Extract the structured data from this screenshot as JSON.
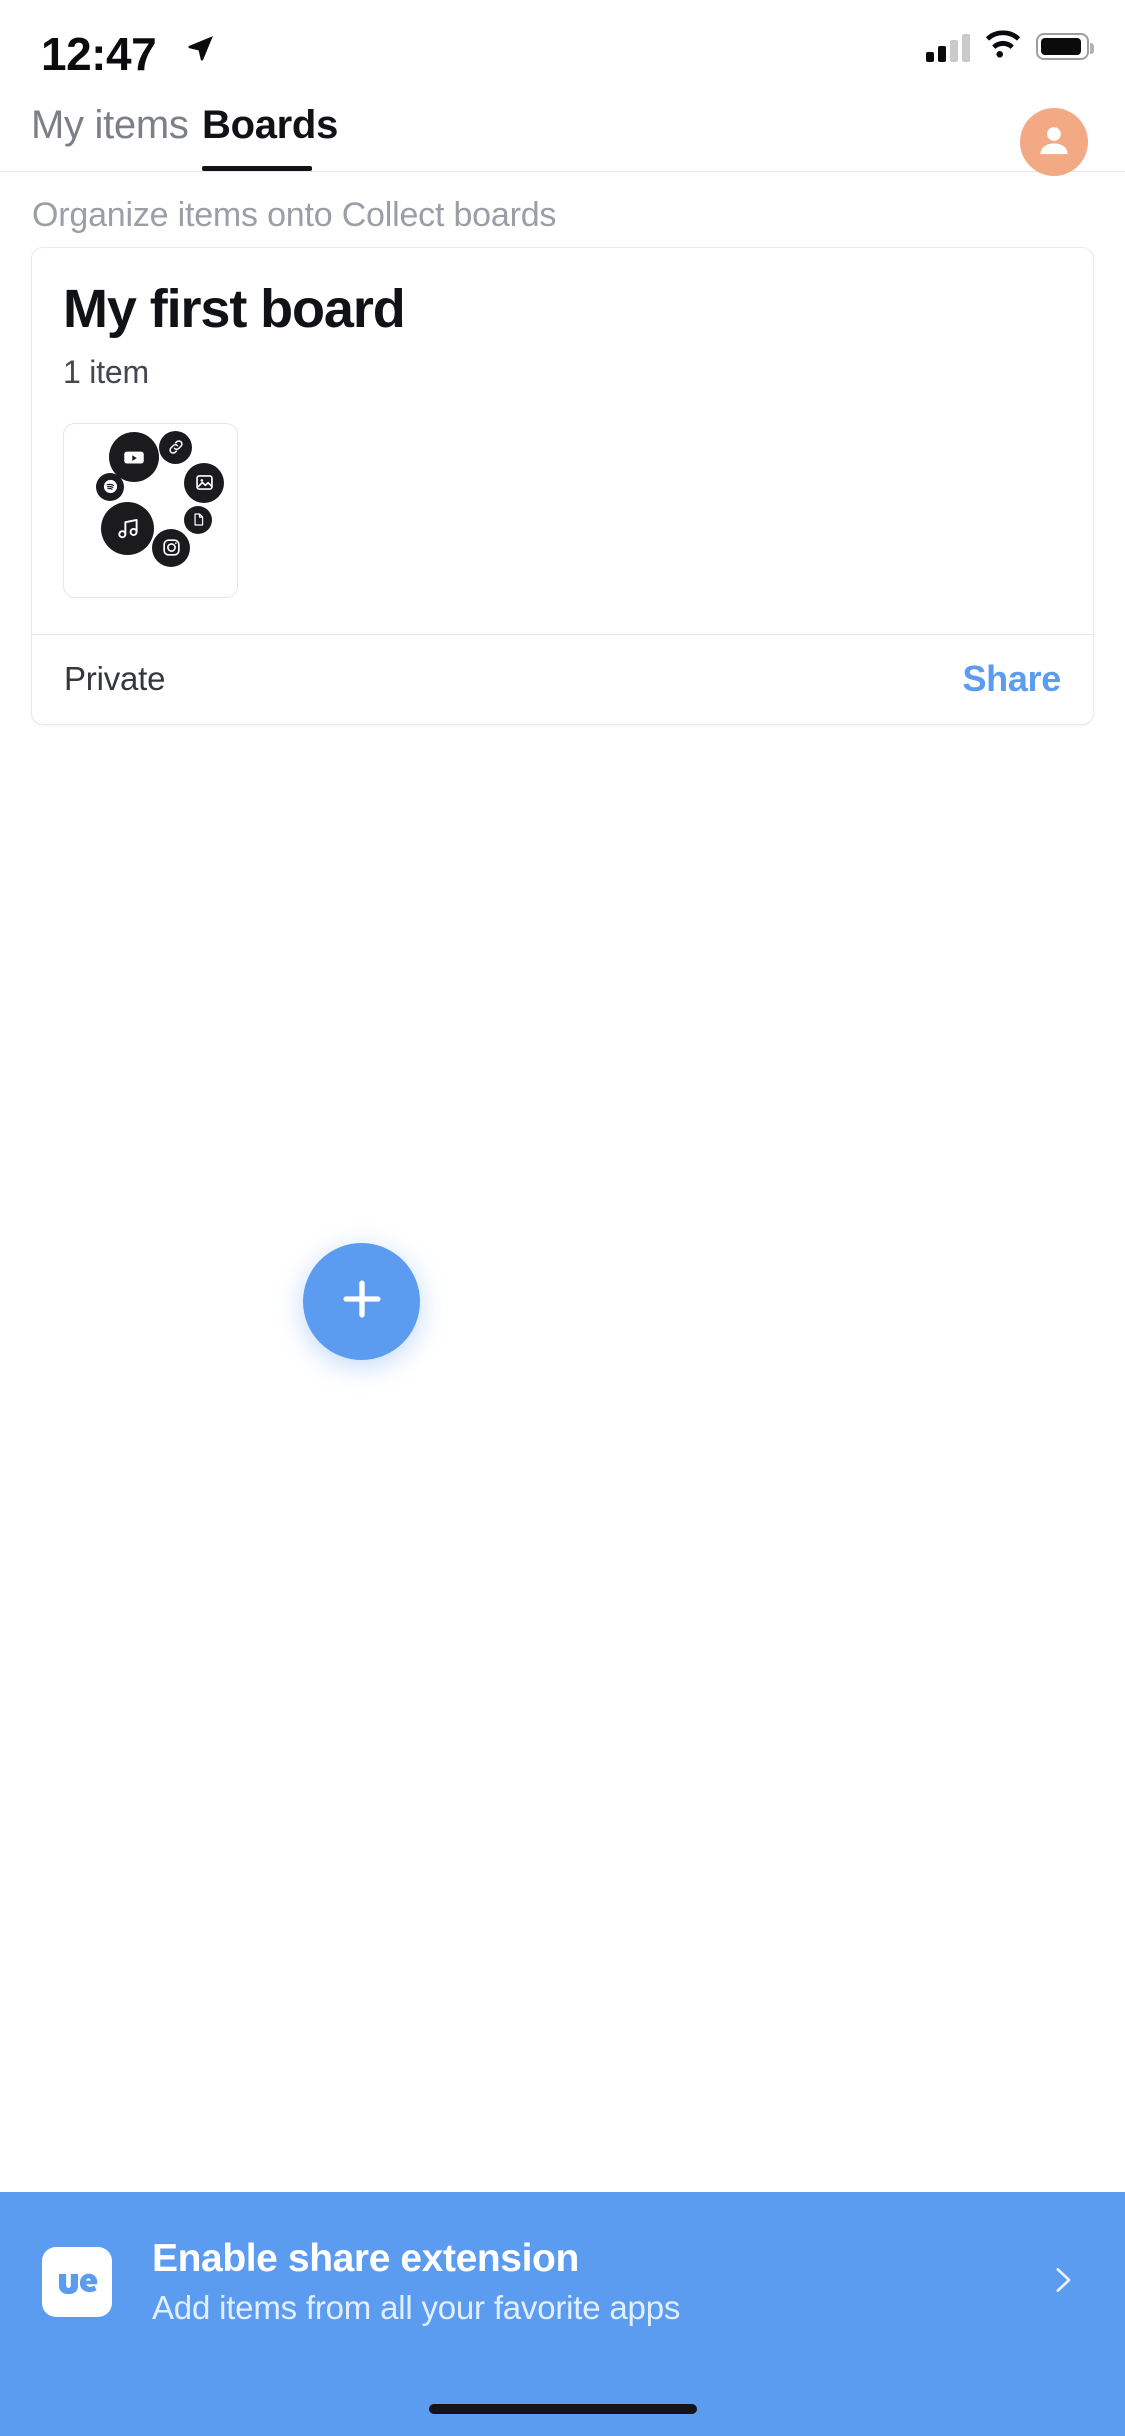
{
  "status_bar": {
    "time": "12:47",
    "location_icon": "location-arrow-icon",
    "signal_icon": "cellular-signal-icon",
    "signal_bars_filled": 2,
    "signal_bars_total": 4,
    "wifi_icon": "wifi-icon",
    "battery_icon": "battery-icon",
    "battery_level_pct": 85
  },
  "tabs": {
    "items": [
      {
        "label": "My items",
        "active": false
      },
      {
        "label": "Boards",
        "active": true
      }
    ],
    "active_index": 1,
    "avatar_icon": "person-icon",
    "avatar_color": "#f3a983"
  },
  "caption": "Organize items onto Collect boards",
  "board_card": {
    "title": "My first board",
    "item_count_label": "1 item",
    "thumbnail_icons": [
      "youtube-icon",
      "link-icon",
      "spotify-icon",
      "image-icon",
      "document-icon",
      "music-note-icon",
      "instagram-icon"
    ],
    "visibility_label": "Private",
    "share_label": "Share",
    "share_color": "#5b9cf0"
  },
  "fab": {
    "icon": "plus-icon",
    "color": "#5b9cf0"
  },
  "banner": {
    "logo_icon": "wetransfer-logo-icon",
    "title": "Enable share extension",
    "subtitle": "Add items from all your favorite apps",
    "chevron_icon": "chevron-right-icon",
    "background_color": "#5b9cf0"
  },
  "home_indicator": "home-indicator"
}
